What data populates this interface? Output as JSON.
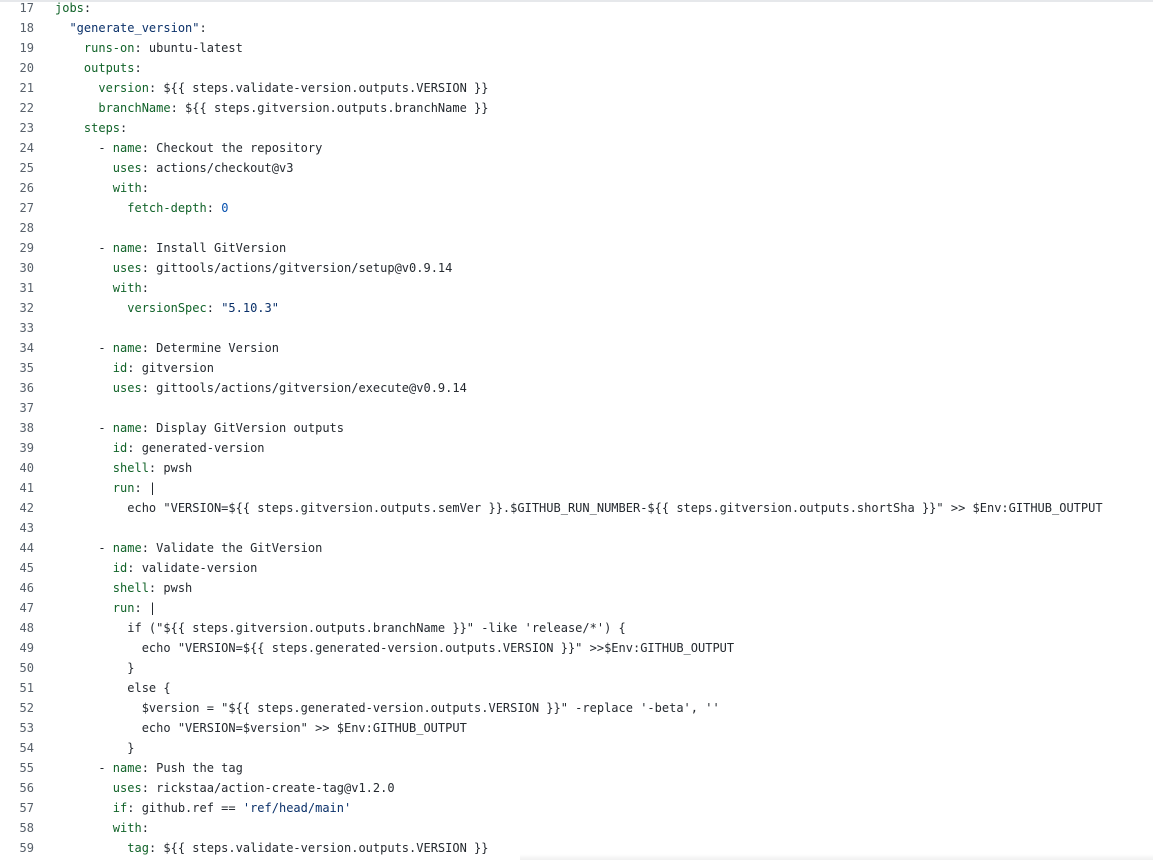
{
  "editor": {
    "lines": [
      {
        "n": "17",
        "tokens": [
          {
            "t": "jobs",
            "c": "key"
          },
          {
            "t": ":",
            "c": "plain"
          }
        ]
      },
      {
        "n": "18",
        "tokens": [
          {
            "t": "  ",
            "c": "plain"
          },
          {
            "t": "\"generate_version\"",
            "c": "str"
          },
          {
            "t": ":",
            "c": "plain"
          }
        ]
      },
      {
        "n": "19",
        "tokens": [
          {
            "t": "    ",
            "c": "plain"
          },
          {
            "t": "runs-on",
            "c": "key"
          },
          {
            "t": ": ubuntu-latest",
            "c": "plain"
          }
        ]
      },
      {
        "n": "20",
        "tokens": [
          {
            "t": "    ",
            "c": "plain"
          },
          {
            "t": "outputs",
            "c": "key"
          },
          {
            "t": ":",
            "c": "plain"
          }
        ]
      },
      {
        "n": "21",
        "tokens": [
          {
            "t": "      ",
            "c": "plain"
          },
          {
            "t": "version",
            "c": "key"
          },
          {
            "t": ": ${{ steps.validate-version.outputs.VERSION }}",
            "c": "plain"
          }
        ]
      },
      {
        "n": "22",
        "tokens": [
          {
            "t": "      ",
            "c": "plain"
          },
          {
            "t": "branchName",
            "c": "key"
          },
          {
            "t": ": ${{ steps.gitversion.outputs.branchName }}",
            "c": "plain"
          }
        ]
      },
      {
        "n": "23",
        "tokens": [
          {
            "t": "    ",
            "c": "plain"
          },
          {
            "t": "steps",
            "c": "key"
          },
          {
            "t": ":",
            "c": "plain"
          }
        ]
      },
      {
        "n": "24",
        "tokens": [
          {
            "t": "      - ",
            "c": "plain"
          },
          {
            "t": "name",
            "c": "key"
          },
          {
            "t": ": Checkout the repository",
            "c": "plain"
          }
        ]
      },
      {
        "n": "25",
        "tokens": [
          {
            "t": "        ",
            "c": "plain"
          },
          {
            "t": "uses",
            "c": "key"
          },
          {
            "t": ": actions/checkout@v3",
            "c": "plain"
          }
        ]
      },
      {
        "n": "26",
        "tokens": [
          {
            "t": "        ",
            "c": "plain"
          },
          {
            "t": "with",
            "c": "key"
          },
          {
            "t": ":",
            "c": "plain"
          }
        ]
      },
      {
        "n": "27",
        "tokens": [
          {
            "t": "          ",
            "c": "plain"
          },
          {
            "t": "fetch-depth",
            "c": "key"
          },
          {
            "t": ": ",
            "c": "plain"
          },
          {
            "t": "0",
            "c": "num"
          }
        ]
      },
      {
        "n": "28",
        "tokens": []
      },
      {
        "n": "29",
        "tokens": [
          {
            "t": "      - ",
            "c": "plain"
          },
          {
            "t": "name",
            "c": "key"
          },
          {
            "t": ": Install GitVersion",
            "c": "plain"
          }
        ]
      },
      {
        "n": "30",
        "tokens": [
          {
            "t": "        ",
            "c": "plain"
          },
          {
            "t": "uses",
            "c": "key"
          },
          {
            "t": ": gittools/actions/gitversion/setup@v0.9.14",
            "c": "plain"
          }
        ]
      },
      {
        "n": "31",
        "tokens": [
          {
            "t": "        ",
            "c": "plain"
          },
          {
            "t": "with",
            "c": "key"
          },
          {
            "t": ":",
            "c": "plain"
          }
        ]
      },
      {
        "n": "32",
        "tokens": [
          {
            "t": "          ",
            "c": "plain"
          },
          {
            "t": "versionSpec",
            "c": "key"
          },
          {
            "t": ": ",
            "c": "plain"
          },
          {
            "t": "\"5.10.3\"",
            "c": "str"
          }
        ]
      },
      {
        "n": "33",
        "tokens": []
      },
      {
        "n": "34",
        "tokens": [
          {
            "t": "      - ",
            "c": "plain"
          },
          {
            "t": "name",
            "c": "key"
          },
          {
            "t": ": Determine Version",
            "c": "plain"
          }
        ]
      },
      {
        "n": "35",
        "tokens": [
          {
            "t": "        ",
            "c": "plain"
          },
          {
            "t": "id",
            "c": "key"
          },
          {
            "t": ": gitversion",
            "c": "plain"
          }
        ]
      },
      {
        "n": "36",
        "tokens": [
          {
            "t": "        ",
            "c": "plain"
          },
          {
            "t": "uses",
            "c": "key"
          },
          {
            "t": ": gittools/actions/gitversion/execute@v0.9.14",
            "c": "plain"
          }
        ]
      },
      {
        "n": "37",
        "tokens": []
      },
      {
        "n": "38",
        "tokens": [
          {
            "t": "      - ",
            "c": "plain"
          },
          {
            "t": "name",
            "c": "key"
          },
          {
            "t": ": Display GitVersion outputs",
            "c": "plain"
          }
        ]
      },
      {
        "n": "39",
        "tokens": [
          {
            "t": "        ",
            "c": "plain"
          },
          {
            "t": "id",
            "c": "key"
          },
          {
            "t": ": generated-version",
            "c": "plain"
          }
        ]
      },
      {
        "n": "40",
        "tokens": [
          {
            "t": "        ",
            "c": "plain"
          },
          {
            "t": "shell",
            "c": "key"
          },
          {
            "t": ": pwsh",
            "c": "plain"
          }
        ]
      },
      {
        "n": "41",
        "tokens": [
          {
            "t": "        ",
            "c": "plain"
          },
          {
            "t": "run",
            "c": "key"
          },
          {
            "t": ": |",
            "c": "plain"
          }
        ]
      },
      {
        "n": "42",
        "tokens": [
          {
            "t": "          echo \"VERSION=${{ steps.gitversion.outputs.semVer }}.$GITHUB_RUN_NUMBER-${{ steps.gitversion.outputs.shortSha }}\" >> $Env:GITHUB_OUTPUT",
            "c": "plain"
          }
        ]
      },
      {
        "n": "43",
        "tokens": []
      },
      {
        "n": "44",
        "tokens": [
          {
            "t": "      - ",
            "c": "plain"
          },
          {
            "t": "name",
            "c": "key"
          },
          {
            "t": ": Validate the GitVersion",
            "c": "plain"
          }
        ]
      },
      {
        "n": "45",
        "tokens": [
          {
            "t": "        ",
            "c": "plain"
          },
          {
            "t": "id",
            "c": "key"
          },
          {
            "t": ": validate-version",
            "c": "plain"
          }
        ]
      },
      {
        "n": "46",
        "tokens": [
          {
            "t": "        ",
            "c": "plain"
          },
          {
            "t": "shell",
            "c": "key"
          },
          {
            "t": ": pwsh",
            "c": "plain"
          }
        ]
      },
      {
        "n": "47",
        "tokens": [
          {
            "t": "        ",
            "c": "plain"
          },
          {
            "t": "run",
            "c": "key"
          },
          {
            "t": ": |",
            "c": "plain"
          }
        ]
      },
      {
        "n": "48",
        "tokens": [
          {
            "t": "          if (\"${{ steps.gitversion.outputs.branchName }}\" -like 'release/*') {",
            "c": "plain"
          }
        ]
      },
      {
        "n": "49",
        "tokens": [
          {
            "t": "            echo \"VERSION=${{ steps.generated-version.outputs.VERSION }}\" >>$Env:GITHUB_OUTPUT",
            "c": "plain"
          }
        ]
      },
      {
        "n": "50",
        "tokens": [
          {
            "t": "          }",
            "c": "plain"
          }
        ]
      },
      {
        "n": "51",
        "tokens": [
          {
            "t": "          else {",
            "c": "plain"
          }
        ]
      },
      {
        "n": "52",
        "tokens": [
          {
            "t": "            $version = \"${{ steps.generated-version.outputs.VERSION }}\" -replace '-beta', ''",
            "c": "plain"
          }
        ]
      },
      {
        "n": "53",
        "tokens": [
          {
            "t": "            echo \"VERSION=$version\" >> $Env:GITHUB_OUTPUT",
            "c": "plain"
          }
        ]
      },
      {
        "n": "54",
        "tokens": [
          {
            "t": "          }",
            "c": "plain"
          }
        ]
      },
      {
        "n": "55",
        "tokens": [
          {
            "t": "      - ",
            "c": "plain"
          },
          {
            "t": "name",
            "c": "key"
          },
          {
            "t": ": Push the tag",
            "c": "plain"
          }
        ]
      },
      {
        "n": "56",
        "tokens": [
          {
            "t": "        ",
            "c": "plain"
          },
          {
            "t": "uses",
            "c": "key"
          },
          {
            "t": ": rickstaa/action-create-tag@v1.2.0",
            "c": "plain"
          }
        ]
      },
      {
        "n": "57",
        "tokens": [
          {
            "t": "        ",
            "c": "plain"
          },
          {
            "t": "if",
            "c": "key"
          },
          {
            "t": ": github.ref == ",
            "c": "plain"
          },
          {
            "t": "'ref/head/main'",
            "c": "str"
          }
        ]
      },
      {
        "n": "58",
        "tokens": [
          {
            "t": "        ",
            "c": "plain"
          },
          {
            "t": "with",
            "c": "key"
          },
          {
            "t": ":",
            "c": "plain"
          }
        ]
      },
      {
        "n": "59",
        "tokens": [
          {
            "t": "          ",
            "c": "plain"
          },
          {
            "t": "tag",
            "c": "key"
          },
          {
            "t": ": ${{ steps.validate-version.outputs.VERSION }}",
            "c": "plain"
          }
        ]
      }
    ]
  },
  "colors": {
    "key": "#116329",
    "string": "#0a3069",
    "plain": "#24292f",
    "number": "#0550ae",
    "line_number": "#57606a",
    "background": "#ffffff"
  }
}
